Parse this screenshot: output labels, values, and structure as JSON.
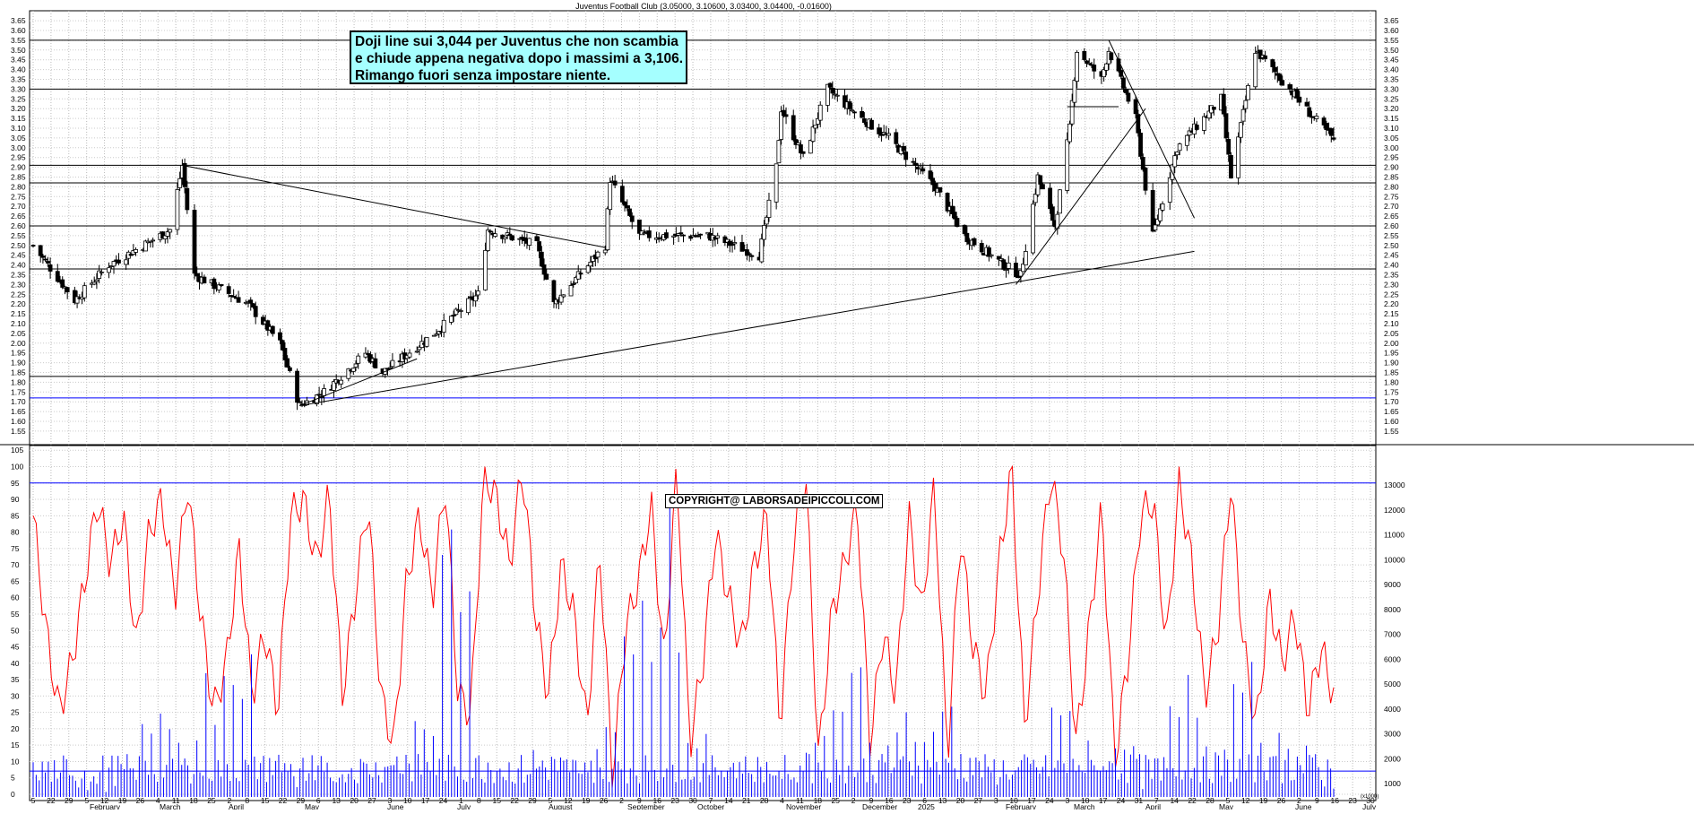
{
  "title": "Juventus  Football Club (3.05000, 3.10600, 3.03400, 3.04400, -0.01600)",
  "annotation": {
    "line1": "Doji line sui 3,044 per Juventus che non scambia",
    "line2": "e chiude appena negativa dopo i massimi a 3,106.",
    "line3": "Rimango fuori senza impostare niente."
  },
  "copyright": "COPYRIGHT@ LABORSADEIPICCOLI.COM",
  "colors": {
    "candle_up": "#ffffff",
    "candle_down": "#000000",
    "oscillator": "#ff0000",
    "volume": "#0000ff",
    "level_blue": "#0000ff",
    "annotation_bg": "#a5ffff"
  },
  "chart_data": [
    {
      "type": "candlestick",
      "title": "Juventus  Football Club (3.05000, 3.10600, 3.03400, 3.04400, -0.01600)",
      "last_bar": {
        "open": 3.05,
        "high": 3.106,
        "low": 3.034,
        "close": 3.044,
        "change": -0.016
      },
      "ylim": [
        1.5,
        3.68
      ],
      "y_ticks": [
        "1.55",
        "1.60",
        "1.65",
        "1.70",
        "1.75",
        "1.80",
        "1.85",
        "1.90",
        "1.95",
        "2.00",
        "2.05",
        "2.10",
        "2.15",
        "2.20",
        "2.25",
        "2.30",
        "2.35",
        "2.40",
        "2.45",
        "2.50",
        "2.55",
        "2.60",
        "2.65",
        "2.70",
        "2.75",
        "2.80",
        "2.85",
        "2.90",
        "2.95",
        "3.00",
        "3.05",
        "3.10",
        "3.15",
        "3.20",
        "3.25",
        "3.30",
        "3.35",
        "3.40",
        "3.45",
        "3.50",
        "3.55",
        "3.60",
        "3.65"
      ],
      "x_day_ticks": [
        "5",
        "22",
        "29",
        "5",
        "12",
        "19",
        "26",
        "4",
        "11",
        "18",
        "25",
        "2",
        "8",
        "15",
        "22",
        "29",
        "6",
        "13",
        "20",
        "27",
        "3",
        "10",
        "17",
        "24",
        "1",
        "8",
        "15",
        "22",
        "29",
        "5",
        "12",
        "19",
        "26",
        "2",
        "9",
        "16",
        "23",
        "30",
        "7",
        "14",
        "21",
        "28",
        "4",
        "11",
        "18",
        "25",
        "2",
        "9",
        "16",
        "23",
        "6",
        "13",
        "20",
        "27",
        "3",
        "10",
        "17",
        "24",
        "3",
        "10",
        "17",
        "24",
        "31",
        "7",
        "14",
        "22",
        "28",
        "5",
        "12",
        "19",
        "26",
        "2",
        "9",
        "16",
        "23",
        "30"
      ],
      "x_month_labels": [
        "February",
        "March",
        "April",
        "May",
        "June",
        "July",
        "August",
        "September",
        "October",
        "November",
        "December",
        "2025",
        "February",
        "March",
        "April",
        "May",
        "June",
        "July"
      ],
      "horizontal_levels": [
        1.72,
        1.83,
        2.38,
        2.6,
        2.82,
        2.91,
        3.3,
        3.55
      ],
      "blue_levels": [
        1.72
      ],
      "key_prices": [
        {
          "date": "2024-01-05",
          "close": 2.5
        },
        {
          "date": "2024-01-22",
          "close": 2.22
        },
        {
          "date": "2024-02-05",
          "close": 2.4
        },
        {
          "date": "2024-03-01",
          "close": 2.58
        },
        {
          "date": "2024-03-06",
          "close": 2.91
        },
        {
          "date": "2024-03-11",
          "close": 2.35
        },
        {
          "date": "2024-04-02",
          "close": 2.2
        },
        {
          "date": "2024-04-15",
          "close": 2.0
        },
        {
          "date": "2024-04-23",
          "close": 1.68
        },
        {
          "date": "2024-05-03",
          "close": 1.75
        },
        {
          "date": "2024-05-20",
          "close": 1.95
        },
        {
          "date": "2024-05-27",
          "close": 1.85
        },
        {
          "date": "2024-06-17",
          "close": 2.05
        },
        {
          "date": "2024-07-05",
          "close": 2.25
        },
        {
          "date": "2024-07-09",
          "close": 2.58
        },
        {
          "date": "2024-07-29",
          "close": 2.5
        },
        {
          "date": "2024-08-05",
          "close": 2.2
        },
        {
          "date": "2024-08-26",
          "close": 2.5
        },
        {
          "date": "2024-08-28",
          "close": 2.84
        },
        {
          "date": "2024-09-09",
          "close": 2.55
        },
        {
          "date": "2024-10-07",
          "close": 2.55
        },
        {
          "date": "2024-10-28",
          "close": 2.45
        },
        {
          "date": "2024-11-04",
          "close": 2.9
        },
        {
          "date": "2024-11-06",
          "close": 3.2
        },
        {
          "date": "2024-11-15",
          "close": 2.95
        },
        {
          "date": "2024-11-25",
          "close": 3.3
        },
        {
          "date": "2024-12-09",
          "close": 3.15
        },
        {
          "date": "2024-12-20",
          "close": 3.05
        },
        {
          "date": "2025-01-08",
          "close": 2.8
        },
        {
          "date": "2025-01-20",
          "close": 2.55
        },
        {
          "date": "2025-02-05",
          "close": 2.4
        },
        {
          "date": "2025-02-12",
          "close": 2.35
        },
        {
          "date": "2025-02-19",
          "close": 2.85
        },
        {
          "date": "2025-02-26",
          "close": 2.6
        },
        {
          "date": "2025-03-04",
          "close": 3.1
        },
        {
          "date": "2025-03-07",
          "close": 3.5
        },
        {
          "date": "2025-03-17",
          "close": 3.35
        },
        {
          "date": "2025-03-20",
          "close": 3.5
        },
        {
          "date": "2025-03-31",
          "close": 3.15
        },
        {
          "date": "2025-04-04",
          "close": 2.8
        },
        {
          "date": "2025-04-07",
          "close": 2.55
        },
        {
          "date": "2025-04-17",
          "close": 3.0
        },
        {
          "date": "2025-05-05",
          "close": 3.25
        },
        {
          "date": "2025-05-09",
          "close": 2.85
        },
        {
          "date": "2025-05-19",
          "close": 3.5
        },
        {
          "date": "2025-06-02",
          "close": 3.3
        },
        {
          "date": "2025-06-12",
          "close": 3.15
        },
        {
          "date": "2025-06-20",
          "close": 3.044
        }
      ]
    },
    {
      "type": "line",
      "name": "oscillator",
      "ylim": [
        0,
        100
      ],
      "y_ticks": [
        "0",
        "5",
        "10",
        "15",
        "20",
        "25",
        "30",
        "35",
        "40",
        "45",
        "50",
        "55",
        "60",
        "65",
        "70",
        "75",
        "80",
        "85",
        "90",
        "95",
        "100",
        "105"
      ],
      "reference_level": 95,
      "approx_values": [
        85,
        50,
        25,
        40,
        65,
        90,
        70,
        85,
        45,
        80,
        90,
        60,
        95,
        55,
        25,
        40,
        75,
        30,
        50,
        25,
        85,
        90,
        70,
        92,
        30,
        60,
        90,
        30,
        15,
        65,
        85,
        60,
        95,
        30,
        25,
        98,
        90,
        70,
        100,
        55,
        30,
        70,
        55,
        20,
        75,
        5,
        50,
        65,
        88,
        40,
        100,
        15,
        40,
        80,
        60,
        45,
        70,
        85,
        20,
        75,
        98,
        10,
        55,
        70,
        88,
        15,
        50,
        30,
        85,
        55,
        95,
        10,
        80,
        45,
        30,
        70,
        100,
        20,
        60,
        98,
        75,
        15,
        50,
        88,
        10,
        40,
        85,
        90,
        45,
        95,
        70,
        30,
        50,
        95,
        45,
        20,
        60,
        40,
        55,
        25,
        45,
        30
      ]
    },
    {
      "type": "bar",
      "name": "volume",
      "unit": "x1000",
      "ylim": [
        0,
        13000
      ],
      "y_ticks": [
        "1000",
        "2000",
        "3000",
        "4000",
        "5000",
        "6000",
        "7000",
        "8000",
        "9000",
        "10000",
        "11000",
        "12000",
        "13000"
      ],
      "reference_level": 1500,
      "approx_peak_values": [
        2000,
        1500,
        1200,
        1800,
        4500,
        3200,
        5600,
        6800,
        2500,
        1200,
        1500,
        2200,
        3000,
        4200,
        12000,
        2500,
        1800,
        2600,
        1600,
        3400,
        9500,
        12500,
        3000,
        2500,
        2000,
        1500,
        4200,
        6800,
        3000,
        4500,
        5500,
        2500,
        1800,
        2200,
        5000,
        2800,
        3500,
        1500,
        7000,
        2500,
        6000,
        4000,
        2800,
        1500
      ]
    }
  ]
}
